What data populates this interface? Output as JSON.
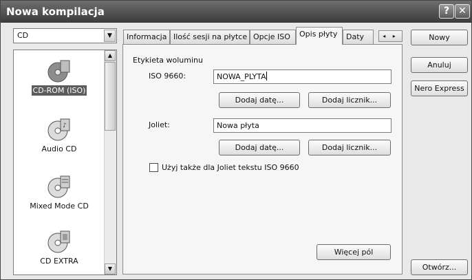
{
  "window": {
    "title": "Nowa kompilacja"
  },
  "titlebar": {
    "help_glyph": "?",
    "close_glyph": "✕"
  },
  "disc_combo": {
    "value": "CD",
    "arrow": "▼"
  },
  "scroll": {
    "up": "▲",
    "down": "▼"
  },
  "disc_types": [
    {
      "label": "CD-ROM (ISO)",
      "icon": "cd-rom-iso-icon",
      "selected": true
    },
    {
      "label": "Audio CD",
      "icon": "audio-cd-icon",
      "selected": false
    },
    {
      "label": "Mixed Mode CD",
      "icon": "mixed-mode-cd-icon",
      "selected": false
    },
    {
      "label": "CD EXTRA",
      "icon": "cd-extra-icon",
      "selected": false
    }
  ],
  "tabs": [
    {
      "label": "Informacja"
    },
    {
      "label": "Ilość sesji na płytce"
    },
    {
      "label": "Opcje ISO"
    },
    {
      "label": "Opis płyty",
      "active": true
    },
    {
      "label": "Daty"
    }
  ],
  "tab_nav": "◂ ▸",
  "panel": {
    "volume_label_heading": "Etykieta woluminu",
    "iso_label": "ISO 9660:",
    "iso_value": "NOWA_PLYTA",
    "add_date": "Dodaj datę...",
    "add_counter": "Dodaj licznik...",
    "joliet_label": "Joliet:",
    "joliet_value": "Nowa płyta",
    "use_iso_checkbox": "Użyj także dla Joliet tekstu ISO 9660",
    "more_fields": "Więcej pól"
  },
  "buttons": {
    "new": "Nowy",
    "cancel": "Anuluj",
    "nero_express": "Nero Express",
    "open": "Otwórz..."
  }
}
